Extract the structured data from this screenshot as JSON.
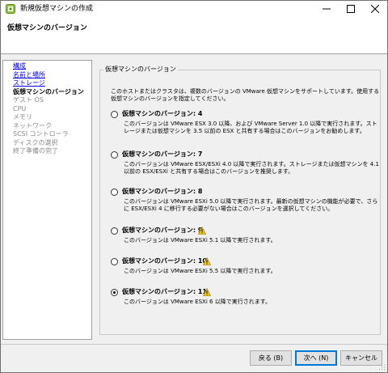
{
  "window": {
    "title": "新規仮想マシンの作成"
  },
  "header": {
    "title": "仮想マシンのバージョン"
  },
  "sidebar": {
    "items": [
      {
        "label": "構成",
        "state": "link"
      },
      {
        "label": "名前と場所",
        "state": "link"
      },
      {
        "label": "ストレージ",
        "state": "link"
      },
      {
        "label": "仮想マシンのバージョン",
        "state": "current"
      },
      {
        "label": "ゲスト OS",
        "state": "disabled"
      },
      {
        "label": "CPU",
        "state": "disabled"
      },
      {
        "label": "メモリ",
        "state": "disabled"
      },
      {
        "label": "ネットワーク",
        "state": "disabled"
      },
      {
        "label": "SCSI コントローラ",
        "state": "disabled"
      },
      {
        "label": "ディスクの選択",
        "state": "disabled"
      },
      {
        "label": "終了準備の完了",
        "state": "disabled"
      }
    ]
  },
  "main": {
    "group_label": "仮想マシンのバージョン",
    "intro": "このホストまたはクラスタは、複数のバージョンの VMware 仮想マシンをサポートしています。使用する仮想マシンのバージョンを指定してください。",
    "options": [
      {
        "label": "仮想マシンのバージョン: 4",
        "warning": false,
        "selected": false,
        "description": "このバージョンは VMware ESX 3.0 以降、および VMware Server 1.0 以降で実行されます。ストレージまたは仮想マシンを 3.5 以前の ESX と共有する場合はこのバージョンをお勧めします。"
      },
      {
        "label": "仮想マシンのバージョン: 7",
        "warning": false,
        "selected": false,
        "description": "このバージョンは VMware ESX/ESXi 4.0 以降で実行されます。ストレージまたは仮想マシンを 4.1 以前の ESX/ESXi と共有する場合はこのバージョンを推奨します。"
      },
      {
        "label": "仮想マシンのバージョン: 8",
        "warning": false,
        "selected": false,
        "description": "このバージョンは VMware ESXi 5.0 以降で実行されます。最新の仮想マシンの機能が必要で、さらに ESX/ESXi 4 に移行する必要がない場合はこのバージョンを選択してください。"
      },
      {
        "label": "仮想マシンのバージョン: 9",
        "warning": true,
        "selected": false,
        "description": "このバージョンは VMware ESXi 5.1 以降で実行されます。"
      },
      {
        "label": "仮想マシンのバージョン: 10",
        "warning": true,
        "selected": false,
        "description": "このバージョンは VMware ESXi 5.5 以降で実行されます。"
      },
      {
        "label": "仮想マシンのバージョン: 11",
        "warning": true,
        "selected": true,
        "description": "このバージョンは VMware ESXi 6 以降で実行されます。"
      }
    ]
  },
  "footer": {
    "back_label": "戻る (<u>B</u>)",
    "back_text": "戻る (B)",
    "next_text": "次へ (N)",
    "cancel_text": "キャンセル"
  },
  "colors": {
    "link": "#0000ee",
    "disabled": "#8a8a8a",
    "warning": "#f2c811",
    "accent": "#0078d7"
  }
}
